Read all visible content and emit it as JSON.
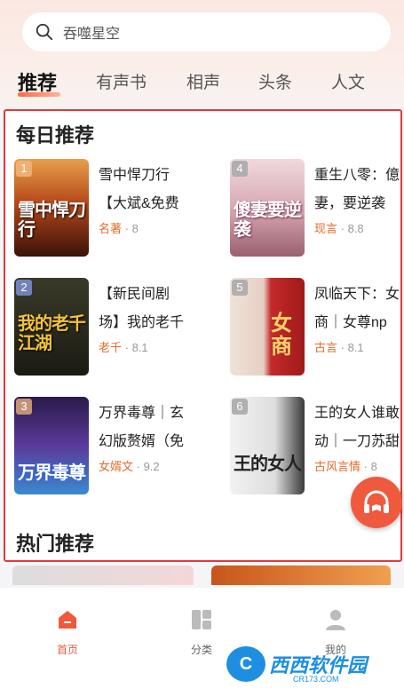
{
  "search": {
    "placeholder": "吞噬星空"
  },
  "tabs": [
    {
      "label": "推荐"
    },
    {
      "label": "有声书"
    },
    {
      "label": "相声"
    },
    {
      "label": "头条"
    },
    {
      "label": "人文"
    }
  ],
  "daily": {
    "title": "每日推荐",
    "books": [
      {
        "rank": "1",
        "line1": "雪中悍刀行",
        "line2": "【大斌&免费",
        "category": "名著",
        "score": "8",
        "cover_text": "雪中悍刀行",
        "cover_color": "#7a2a12"
      },
      {
        "rank": "4",
        "line1": "重生八零：億",
        "line2": "妻，要逆袭",
        "category": "现言",
        "score": "8.8",
        "cover_text": "傻妻要逆袭",
        "cover_color": "#c9a8b0"
      },
      {
        "rank": "2",
        "line1": "【新民间剧",
        "line2": "场】我的老千",
        "category": "老千",
        "score": "8.1",
        "cover_text": "我的老千江湖",
        "cover_color": "#2a2a1a"
      },
      {
        "rank": "5",
        "line1": "凤临天下：女",
        "line2": "商｜女尊np",
        "category": "古言",
        "score": "8.1",
        "cover_text": "女商",
        "cover_color": "#b82a2a"
      },
      {
        "rank": "3",
        "line1": "万界毒尊｜玄",
        "line2": "幻版赘婿（免",
        "category": "女婿文",
        "score": "9.2",
        "cover_text": "万界毒尊",
        "cover_color": "#3a2a6a"
      },
      {
        "rank": "6",
        "line1": "王的女人谁敢",
        "line2": "动｜一刀苏甜",
        "category": "古风言情",
        "score": "8",
        "cover_text": "王的女人",
        "cover_color": "#d8d8d8"
      }
    ]
  },
  "hot": {
    "title": "热门推荐"
  },
  "nav": [
    {
      "label": "首页"
    },
    {
      "label": "分类"
    },
    {
      "label": "我的"
    }
  ],
  "watermark": {
    "brand": "西西软件园",
    "url": "CR173.COM"
  },
  "colors": {
    "accent": "#ef5a3e",
    "highlight_border": "#e23a3a"
  }
}
